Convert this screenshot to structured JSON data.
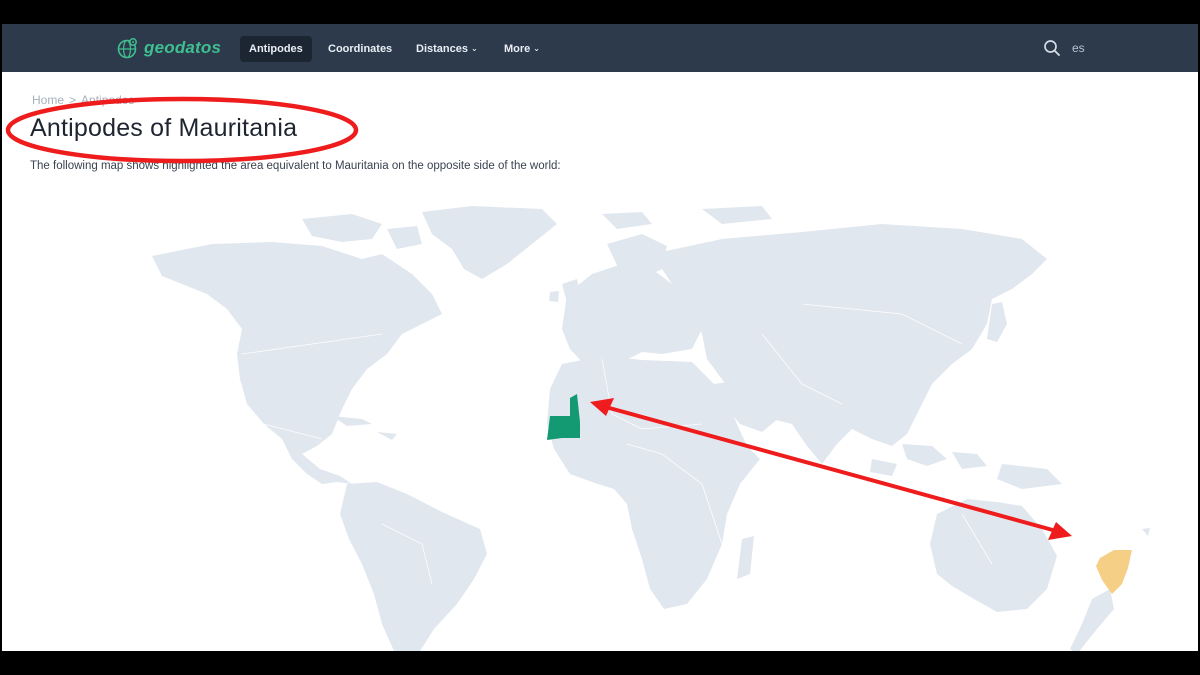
{
  "navbar": {
    "brand": "geodatos",
    "items": [
      {
        "label": "Antipodes",
        "active": true
      },
      {
        "label": "Coordinates"
      },
      {
        "label": "Distances",
        "caret": "⌄"
      },
      {
        "label": "More",
        "caret": "⌄"
      }
    ],
    "lang": "es"
  },
  "breadcrumb": {
    "home": "Home",
    "current": "Antipodes",
    "separator": ">"
  },
  "page": {
    "title": "Antipodes of Mauritania",
    "intro": "The following map shows highlighted the area equivalent to Mauritania on the opposite side of the world:"
  },
  "map": {
    "highlight_color": "#149a72",
    "antipode_color": "#f5cf86",
    "land_color": "#e1e7ef",
    "annotation_color": "#ee1c1c"
  }
}
